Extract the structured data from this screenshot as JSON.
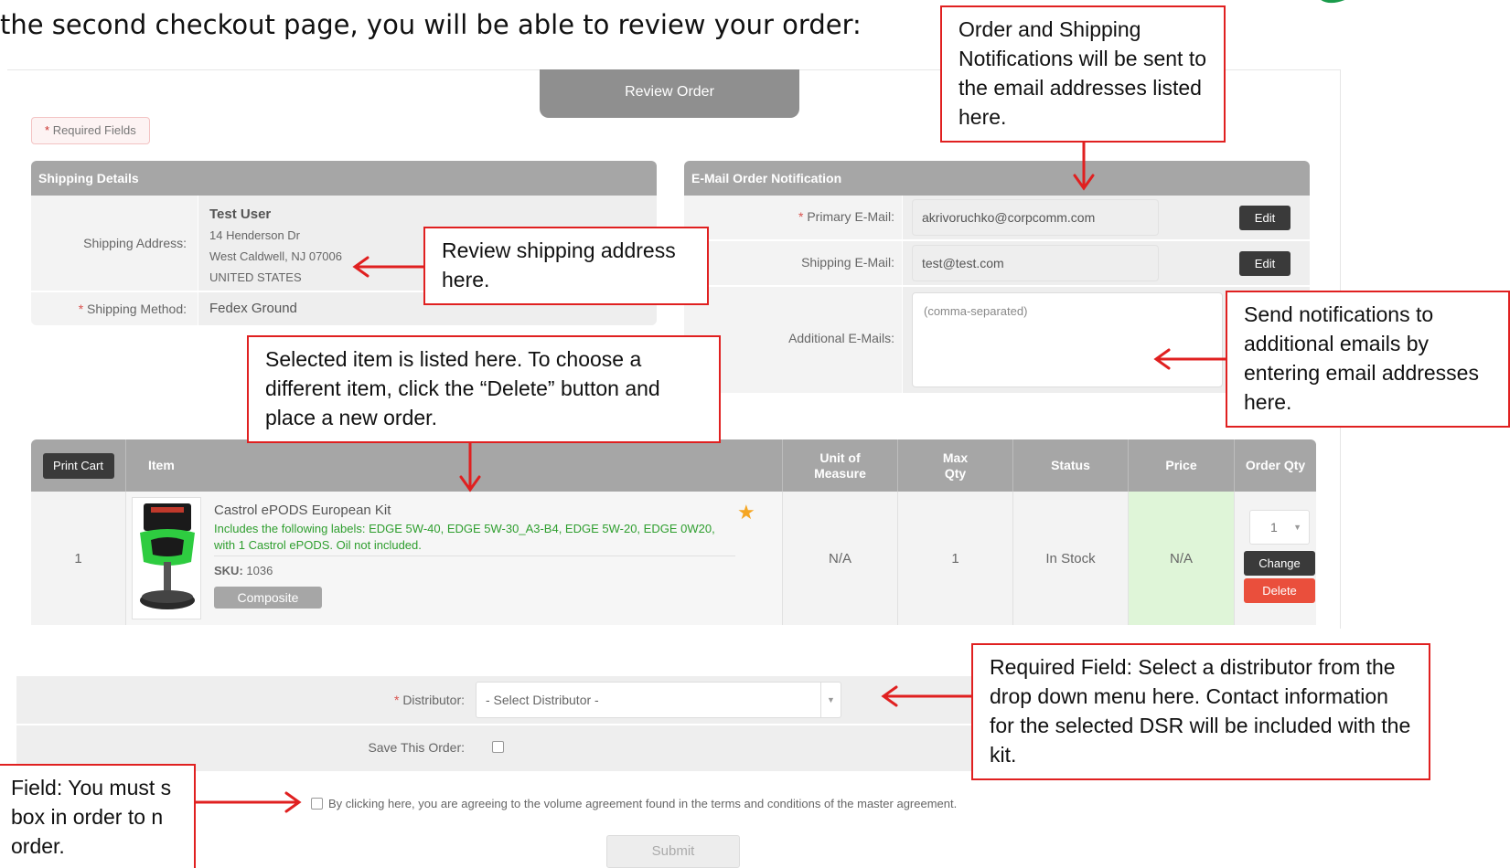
{
  "intro_text": "the second checkout page, you will be able to review your order:",
  "review_tab": "Review Order",
  "required_fields": "Required Fields",
  "required_star": "*",
  "shipping": {
    "header": "Shipping Details",
    "address_label": "Shipping Address:",
    "name": "Test User",
    "street": "14 Henderson Dr",
    "city": "West Caldwell, NJ 07006",
    "country": "UNITED STATES",
    "method_label": "Shipping Method:",
    "method_value": "Fedex Ground"
  },
  "email": {
    "header": "E-Mail Order Notification",
    "primary_label": "Primary E-Mail:",
    "primary_value": "akrivoruchko@corpcomm.com",
    "shipping_label": "Shipping E-Mail:",
    "shipping_value": "test@test.com",
    "edit_label": "Edit",
    "additional_label": "Additional E-Mails:",
    "additional_placeholder": "(comma-separated)"
  },
  "cart": {
    "print_button": "Print Cart",
    "headers": {
      "item": "Item",
      "uom": "Unit of Measure",
      "max_qty": "Max Qty",
      "status": "Status",
      "price": "Price",
      "order_qty": "Order Qty"
    },
    "row": {
      "index": "1",
      "title": "Castrol ePODS European Kit",
      "description": "Includes the following labels: EDGE 5W-40, EDGE 5W-30_A3-B4, EDGE 5W-20, EDGE 0W20, with 1 Castrol ePODS. Oil not included.",
      "sku_label": "SKU:",
      "sku_value": "1036",
      "composite_label": "Composite",
      "uom": "N/A",
      "max_qty": "1",
      "status": "In Stock",
      "price": "N/A",
      "qty": "1",
      "change_label": "Change",
      "delete_label": "Delete"
    }
  },
  "distributor": {
    "label": "Distributor:",
    "placeholder": "- Select Distributor -",
    "save_label": "Save This Order:"
  },
  "agreement_text": "By clicking here, you are agreeing to the volume agreement found in the terms and conditions of the master agreement.",
  "submit_label": "Submit",
  "callouts": {
    "notifications": "Order and Shipping Notifications will be sent to the email addresses listed here.",
    "shipping": "Review shipping address here.",
    "item": "Selected item is listed here. To choose a different item, click the “Delete” button and place a new order.",
    "additional": "Send notifications to additional emails by entering email addresses here.",
    "distributor": "Required Field: Select a distributor from the drop down menu here. Contact information for the selected DSR will be included with the kit.",
    "checkbox": "Field: You must s box in order to n order."
  },
  "colors": {
    "header_gray": "#a6a6a6",
    "callout_red": "#e02020",
    "green_text": "#2e9e2e",
    "delete_red": "#ea4f3c",
    "price_bg": "#dff5d8",
    "star_orange": "#f5a623"
  },
  "icons": {
    "star": "star-icon",
    "dropdown": "chevron-down-icon",
    "product": "product-image"
  }
}
